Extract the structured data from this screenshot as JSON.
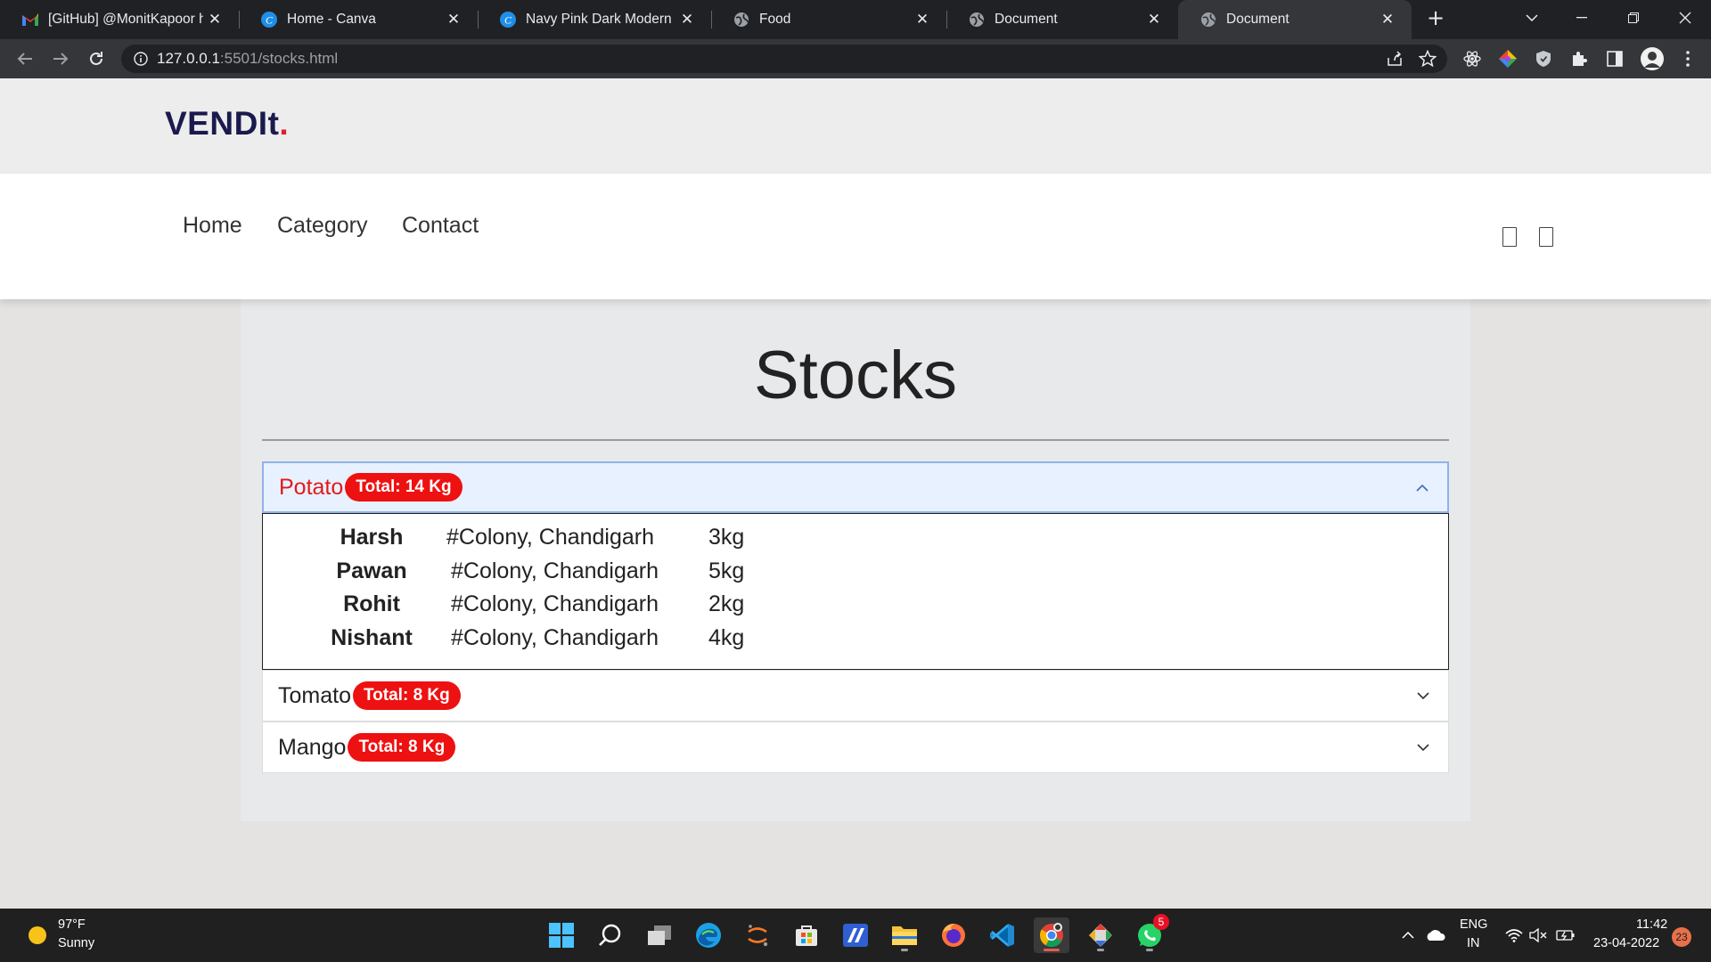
{
  "browser": {
    "tabs": [
      {
        "title": "[GitHub] @MonitKapoor ha",
        "icon": "gmail-icon"
      },
      {
        "title": "Home - Canva",
        "icon": "canva-icon"
      },
      {
        "title": "Navy Pink Dark Modern Tec",
        "icon": "canva-icon"
      },
      {
        "title": "Food",
        "icon": "globe-icon"
      },
      {
        "title": "Document",
        "icon": "globe-icon"
      },
      {
        "title": "Document",
        "icon": "globe-icon",
        "active": true
      }
    ],
    "address": {
      "host": "127.0.0.1",
      "path": ":5501/stocks.html"
    }
  },
  "site": {
    "logo": "VENDIt",
    "logo_dot": ".",
    "nav": [
      "Home",
      "Category",
      "Contact"
    ]
  },
  "stocks": {
    "title": "Stocks",
    "items": [
      {
        "name": "Potato",
        "total": "Total: 14 Kg",
        "expanded": true,
        "rows": [
          {
            "name": "Harsh",
            "address": "#Colony, Chandigarh",
            "qty": "3kg"
          },
          {
            "name": "Pawan",
            "address": "#Colony, Chandigarh",
            "qty": "5kg"
          },
          {
            "name": "Rohit",
            "address": "#Colony, Chandigarh",
            "qty": "2kg"
          },
          {
            "name": "Nishant",
            "address": "#Colony, Chandigarh",
            "qty": "4kg"
          }
        ]
      },
      {
        "name": "Tomato",
        "total": "Total: 8 Kg",
        "expanded": false
      },
      {
        "name": "Mango",
        "total": "Total: 8 Kg",
        "expanded": false
      }
    ]
  },
  "taskbar": {
    "weather_temp": "97°F",
    "weather_desc": "Sunny",
    "lang_top": "ENG",
    "lang_bottom": "IN",
    "time": "11:42",
    "date": "23-04-2022",
    "notif_count": "23",
    "whatsapp_badge": "5"
  },
  "colors": {
    "accent_red": "#ee1111",
    "logo_navy": "#1a1a4e",
    "open_header_bg": "#e7f1ff"
  }
}
